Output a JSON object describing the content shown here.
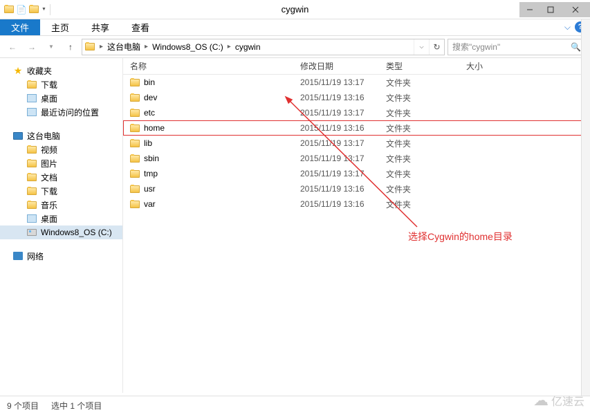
{
  "title": "cygwin",
  "ribbon": {
    "file": "文件",
    "tabs": [
      "主页",
      "共享",
      "查看"
    ]
  },
  "breadcrumbs": [
    "这台电脑",
    "Windows8_OS (C:)",
    "cygwin"
  ],
  "search_placeholder": "搜索\"cygwin\"",
  "columns": {
    "name": "名称",
    "date": "修改日期",
    "type": "类型",
    "size": "大小"
  },
  "sidebar": {
    "favorites": {
      "label": "收藏夹",
      "items": [
        "下载",
        "桌面",
        "最近访问的位置"
      ]
    },
    "this_pc": {
      "label": "这台电脑",
      "items": [
        "视频",
        "图片",
        "文档",
        "下载",
        "音乐",
        "桌面",
        "Windows8_OS (C:)"
      ]
    },
    "network": {
      "label": "网络"
    }
  },
  "files": [
    {
      "name": "bin",
      "date": "2015/11/19 13:17",
      "type": "文件夹",
      "selected": false
    },
    {
      "name": "dev",
      "date": "2015/11/19 13:16",
      "type": "文件夹",
      "selected": false
    },
    {
      "name": "etc",
      "date": "2015/11/19 13:17",
      "type": "文件夹",
      "selected": false
    },
    {
      "name": "home",
      "date": "2015/11/19 13:16",
      "type": "文件夹",
      "selected": true
    },
    {
      "name": "lib",
      "date": "2015/11/19 13:17",
      "type": "文件夹",
      "selected": false
    },
    {
      "name": "sbin",
      "date": "2015/11/19 13:17",
      "type": "文件夹",
      "selected": false
    },
    {
      "name": "tmp",
      "date": "2015/11/19 13:17",
      "type": "文件夹",
      "selected": false
    },
    {
      "name": "usr",
      "date": "2015/11/19 13:16",
      "type": "文件夹",
      "selected": false
    },
    {
      "name": "var",
      "date": "2015/11/19 13:16",
      "type": "文件夹",
      "selected": false
    }
  ],
  "annotation": "选择Cygwin的home目录",
  "status": {
    "items": "9 个项目",
    "selected": "选中 1 个项目"
  },
  "watermark": "亿速云"
}
